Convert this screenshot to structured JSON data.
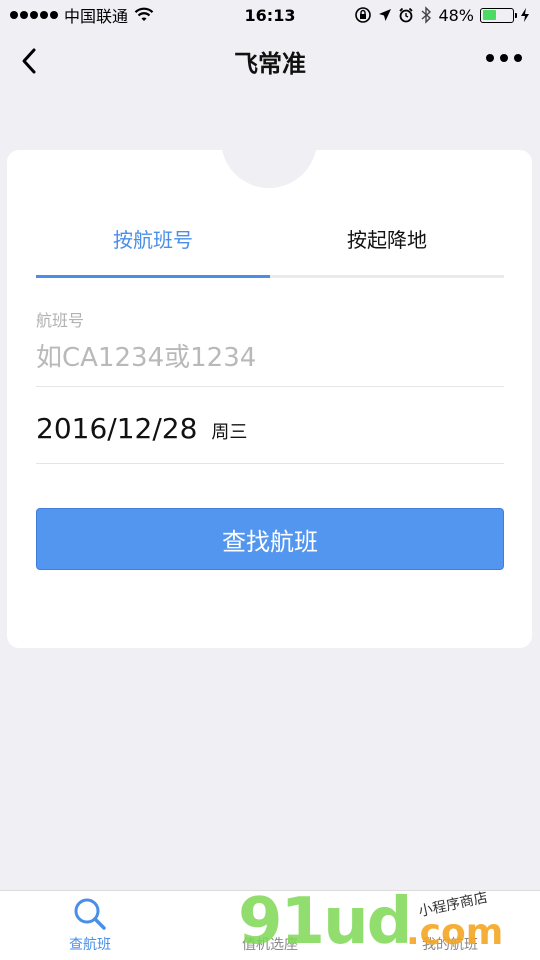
{
  "status_bar": {
    "carrier": "中国联通",
    "time": "16:13",
    "battery": "48%",
    "battery_level": 0.48
  },
  "nav": {
    "title": "飞常准"
  },
  "tabs": [
    {
      "label": "按航班号",
      "active": true
    },
    {
      "label": "按起降地",
      "active": false
    }
  ],
  "form": {
    "flight_label": "航班号",
    "flight_placeholder": "如CA1234或1234",
    "date": "2016/12/28",
    "weekday": "周三",
    "search_button": "查找航班"
  },
  "tab_bar": {
    "items": [
      {
        "label": "查航班",
        "icon": "search-icon",
        "active": true
      },
      {
        "label": "值机选座",
        "icon": "checkin-icon",
        "active": false
      },
      {
        "label": "我的航班",
        "icon": "my-flight-icon",
        "active": false
      }
    ]
  },
  "watermark": {
    "main": "91ud",
    "domain": ".com",
    "sub": "小程序商店"
  },
  "colors": {
    "accent": "#4a8fe7",
    "button": "#5396f0",
    "background": "#efeff4"
  }
}
